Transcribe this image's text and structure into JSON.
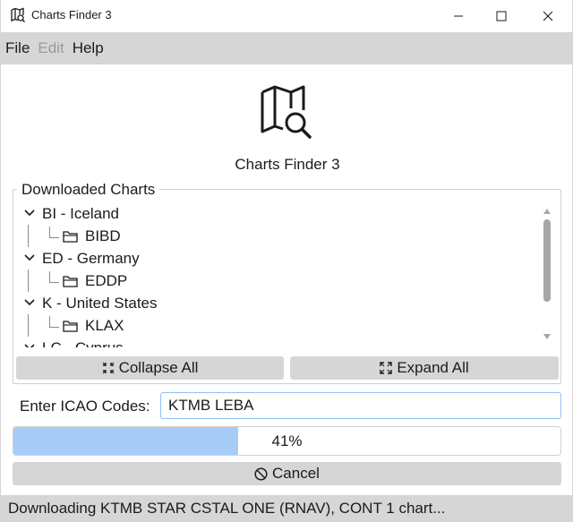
{
  "window": {
    "title": "Charts Finder 3"
  },
  "menu": {
    "file": "File",
    "edit": "Edit",
    "help": "Help"
  },
  "app": {
    "name": "Charts Finder 3"
  },
  "downloaded": {
    "group_title": "Downloaded Charts",
    "countries": [
      {
        "label": "BI - Iceland",
        "airports": [
          "BIBD"
        ]
      },
      {
        "label": "ED - Germany",
        "airports": [
          "EDDP"
        ]
      },
      {
        "label": "K - United States",
        "airports": [
          "KLAX"
        ]
      },
      {
        "label": "LC - Cyprus",
        "airports": []
      }
    ],
    "collapse_label": "Collapse All",
    "expand_label": "Expand All"
  },
  "icao": {
    "label": "Enter ICAO Codes:",
    "value": "KTMB LEBA"
  },
  "progress": {
    "percent": 41,
    "text": "41%"
  },
  "cancel_label": "Cancel",
  "status": {
    "text": "Downloading KTMB STAR CSTAL ONE (RNAV), CONT 1 chart..."
  },
  "colors": {
    "menubar": "#d6d6d6",
    "progress_fill": "#a7cdf6",
    "input_border": "#8fc3f5"
  }
}
